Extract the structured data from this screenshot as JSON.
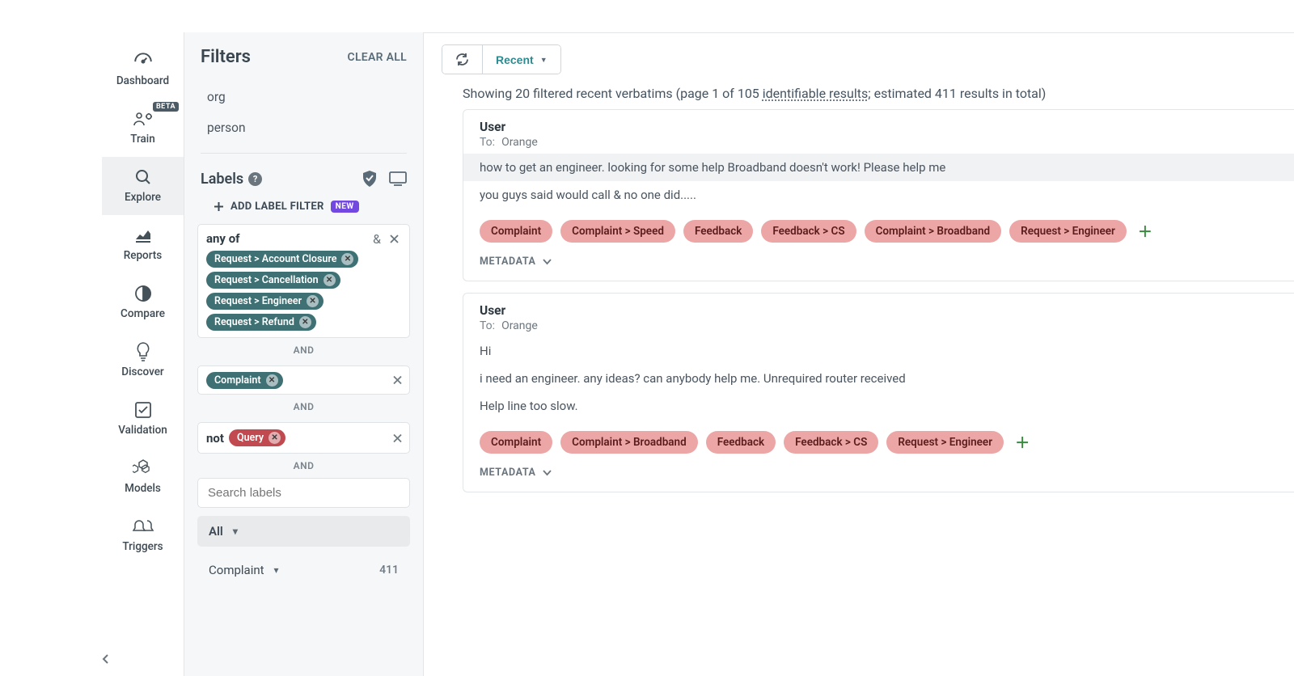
{
  "nav": {
    "dashboard": "Dashboard",
    "train": "Train",
    "train_badge": "BETA",
    "explore": "Explore",
    "reports": "Reports",
    "compare": "Compare",
    "discover": "Discover",
    "validation": "Validation",
    "models": "Models",
    "triggers": "Triggers"
  },
  "filters": {
    "title": "Filters",
    "clear_all": "CLEAR ALL",
    "fields": {
      "org": "org",
      "person": "person"
    },
    "labels_title": "Labels",
    "add_label_filter": "ADD LABEL FILTER",
    "new_badge": "NEW",
    "anyof": "any of",
    "anyof_chips": [
      "Request > Account Closure",
      "Request > Cancellation",
      "Request > Engineer",
      "Request > Refund"
    ],
    "amp": "&",
    "and": "AND",
    "complaint_chip": "Complaint",
    "not_label": "not",
    "query_chip": "Query",
    "search_placeholder": "Search labels",
    "all_label": "All",
    "complaint_row": "Complaint",
    "complaint_count": "411"
  },
  "toolbar": {
    "recent": "Recent"
  },
  "results": {
    "prefix": "Showing 20 filtered recent verbatims (page 1 of 105 ",
    "link": "identifiable results",
    "suffix": "; estimated 411 results in total)"
  },
  "cards": [
    {
      "user": "User",
      "to_label": "To:",
      "to_value": "Orange",
      "lines": [
        {
          "text": "how to get an engineer. looking for some help Broadband doesn't work! Please help me",
          "hl": true
        },
        {
          "text": "you guys said would call & no one did.....",
          "hl": false
        }
      ],
      "tags": [
        "Complaint",
        "Complaint > Speed",
        "Feedback",
        "Feedback > CS",
        "Complaint > Broadband",
        "Request > Engineer"
      ],
      "metadata": "METADATA"
    },
    {
      "user": "User",
      "to_label": "To:",
      "to_value": "Orange",
      "lines": [
        {
          "text": "Hi",
          "hl": false
        },
        {
          "text": "i need an engineer. any ideas? can anybody help me. Unrequired router received",
          "hl": false
        },
        {
          "text": "Help line too slow.",
          "hl": false
        }
      ],
      "tags": [
        "Complaint",
        "Complaint > Broadband",
        "Feedback",
        "Feedback > CS",
        "Request > Engineer"
      ],
      "metadata": "METADATA"
    }
  ]
}
